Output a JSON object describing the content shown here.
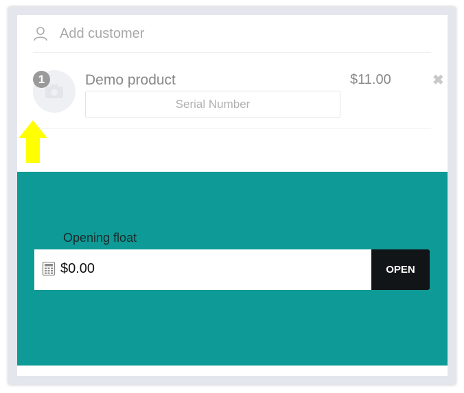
{
  "customer": {
    "label": "Add customer",
    "icon": "user-icon"
  },
  "cart": {
    "items": [
      {
        "quantity": "1",
        "name": "Demo product",
        "serial_placeholder": "Serial Number",
        "price": "$11.00",
        "remove_icon": "close-icon"
      }
    ]
  },
  "register": {
    "float_label": "Opening float",
    "float_value": "$0.00",
    "open_label": "OPEN",
    "calculator_icon": "calculator-icon"
  },
  "colors": {
    "accent": "#0e9a96",
    "button": "#121517",
    "highlight_arrow": "#ffff00"
  }
}
